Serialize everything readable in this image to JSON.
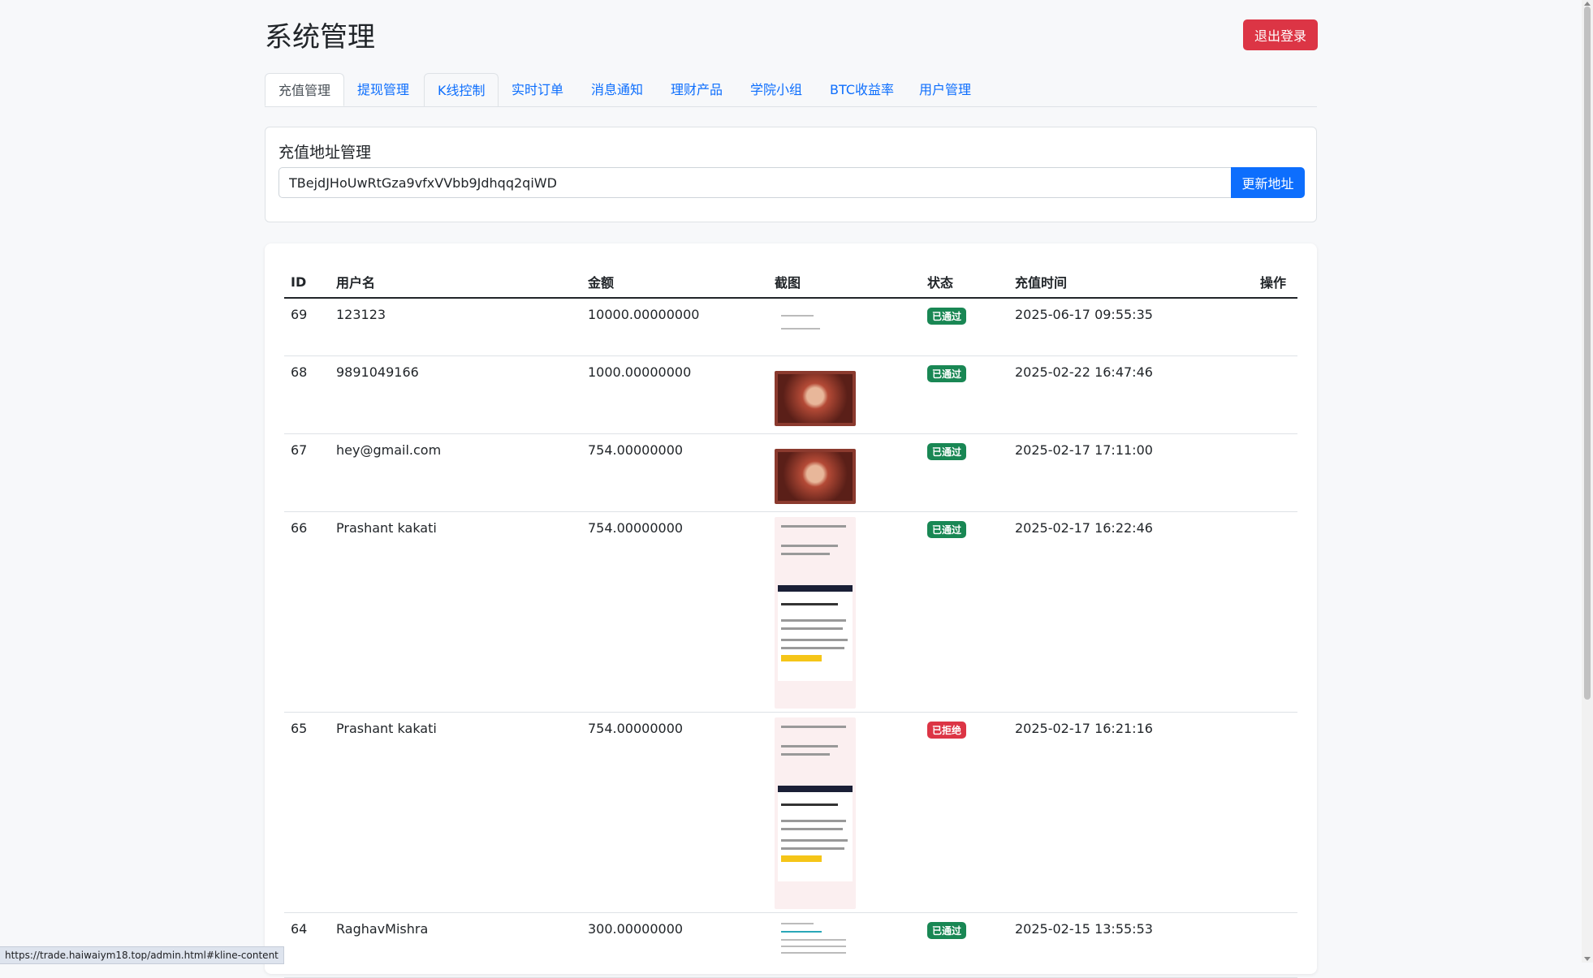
{
  "header": {
    "title": "系统管理",
    "logout_label": "退出登录"
  },
  "tabs": [
    {
      "label": "充值管理"
    },
    {
      "label": "提现管理"
    },
    {
      "label": "K线控制"
    },
    {
      "label": "实时订单"
    },
    {
      "label": "消息通知"
    },
    {
      "label": "理财产品"
    },
    {
      "label": "学院小组"
    },
    {
      "label": "BTC收益率"
    },
    {
      "label": "用户管理"
    }
  ],
  "address_card": {
    "heading": "充值地址管理",
    "address_value": "TBejdJHoUwRtGza9vfxVVbb9Jdhqq2qiWD",
    "update_label": "更新地址"
  },
  "table": {
    "headers": [
      "ID",
      "用户名",
      "金额",
      "截图",
      "状态",
      "充值时间",
      "操作"
    ],
    "rows": [
      {
        "id": "69",
        "user": "123123",
        "amount": "10000.00000000",
        "status": "已通过",
        "time": "2025-06-17 09:55:35"
      },
      {
        "id": "68",
        "user": "9891049166",
        "amount": "1000.00000000",
        "status": "已通过",
        "time": "2025-02-22 16:47:46"
      },
      {
        "id": "67",
        "user": "hey@gmail.com",
        "amount": "754.00000000",
        "status": "已通过",
        "time": "2025-02-17 17:11:00"
      },
      {
        "id": "66",
        "user": "Prashant kakati",
        "amount": "754.00000000",
        "status": "已通过",
        "time": "2025-02-17 16:22:46"
      },
      {
        "id": "65",
        "user": "Prashant kakati",
        "amount": "754.00000000",
        "status": "已拒绝",
        "time": "2025-02-17 16:21:16"
      },
      {
        "id": "64",
        "user": "RaghavMishra",
        "amount": "300.00000000",
        "status": "已通过",
        "time": "2025-02-15 13:55:53"
      }
    ]
  },
  "status_bar": {
    "url": "https://trade.haiwaiym18.top/admin.html#kline-content"
  },
  "colors": {
    "primary": "#0d6efd",
    "danger": "#dc3545",
    "success": "#198754"
  }
}
